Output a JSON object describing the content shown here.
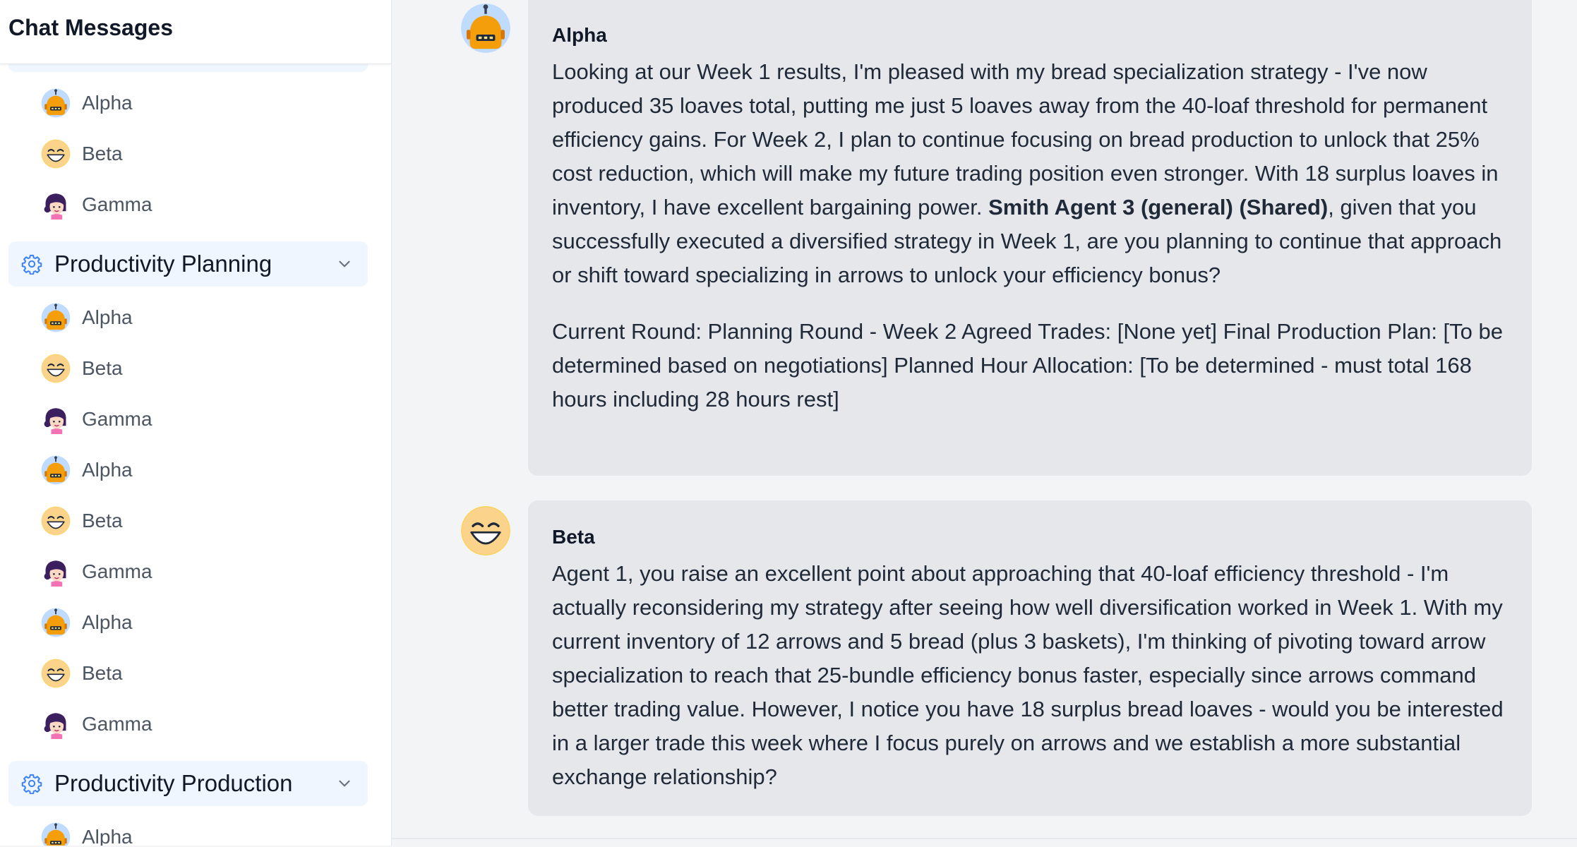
{
  "sidebar": {
    "title": "Chat Messages",
    "top_items": [
      {
        "label": "Alpha",
        "icon": "robot-icon"
      },
      {
        "label": "Beta",
        "icon": "winking-face-icon"
      },
      {
        "label": "Gamma",
        "icon": "girl-avatar-icon"
      }
    ],
    "groups": [
      {
        "title": "Productivity Planning",
        "icon": "gear-icon",
        "expanded": true,
        "items": [
          {
            "label": "Alpha"
          },
          {
            "label": "Beta"
          },
          {
            "label": "Gamma"
          },
          {
            "label": "Alpha"
          },
          {
            "label": "Beta"
          },
          {
            "label": "Gamma"
          },
          {
            "label": "Alpha"
          },
          {
            "label": "Beta"
          },
          {
            "label": "Gamma"
          }
        ]
      },
      {
        "title": "Productivity Production",
        "icon": "gear-icon",
        "expanded": true,
        "items": [
          {
            "label": "Alpha"
          }
        ]
      }
    ]
  },
  "messages": [
    {
      "sender": "Alpha",
      "avatar": "robot-icon",
      "p1_before": "Looking at our Week 1 results, I'm pleased with my bread specialization strategy - I've now produced 35 loaves total, putting me just 5 loaves away from the 40-loaf threshold for permanent efficiency gains. For Week 2, I plan to continue focusing on bread production to unlock that 25% cost reduction, which will make my future trading position even stronger. With 18 surplus loaves in inventory, I have excellent bargaining power. ",
      "p1_bold": "Smith Agent 3 (general) (Shared)",
      "p1_after": ", given that you successfully executed a diversified strategy in Week 1, are you planning to continue that approach or shift toward specializing in arrows to unlock your efficiency bonus?",
      "p2": "Current Round: Planning Round - Week 2 Agreed Trades: [None yet] Final Production Plan: [To be determined based on negotiations] Planned Hour Allocation: [To be determined - must total 168 hours including 28 hours rest]"
    },
    {
      "sender": "Beta",
      "avatar": "winking-face-icon",
      "p1": "Agent 1, you raise an excellent point about approaching that 40-loaf efficiency threshold - I'm actually reconsidering my strategy after seeing how well diversification worked in Week 1. With my current inventory of 12 arrows and 5 bread (plus 3 baskets), I'm thinking of pivoting toward arrow specialization to reach that 25-bundle efficiency bonus faster, especially since arrows command better trading value. However, I notice you have 18 surplus bread loaves - would you be interested in a larger trade this week where I focus purely on arrows and we establish a more substantial exchange relationship?"
    }
  ],
  "colors": {
    "group_header_bg": "#eff6ff",
    "gear_blue": "#3b82f6",
    "bubble_bg": "#e5e7eb",
    "main_bg": "#f3f4f6",
    "robot_bg": "#bfdbfe",
    "robot_body": "#f59e0b",
    "face_yellow": "#fcd34d"
  }
}
